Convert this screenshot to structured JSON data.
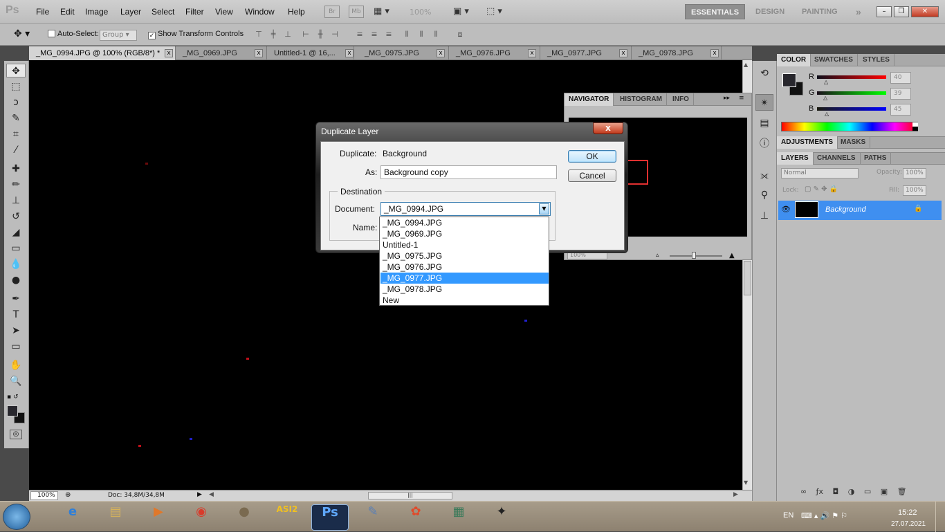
{
  "app": {
    "logo": "Ps"
  },
  "menu": [
    "File",
    "Edit",
    "Image",
    "Layer",
    "Select",
    "Filter",
    "View",
    "Window",
    "Help"
  ],
  "appbar": {
    "br": "Br",
    "mb": "Mb",
    "zoom": "100%"
  },
  "workspaces": {
    "essentials": "ESSENTIALS",
    "design": "DESIGN",
    "painting": "PAINTING",
    "more": "»"
  },
  "window_controls": {
    "minimize": "–",
    "restore": "❐",
    "close": "✕"
  },
  "options": {
    "auto_select_label": "Auto-Select:",
    "auto_select_value": "Group",
    "show_transform_label": "Show Transform Controls"
  },
  "tabs": [
    {
      "label": "_MG_0994.JPG @ 100% (RGB/8*) *"
    },
    {
      "label": "_MG_0969.JPG"
    },
    {
      "label": "Untitled-1 @ 16,..."
    },
    {
      "label": "_MG_0975.JPG"
    },
    {
      "label": "_MG_0976.JPG"
    },
    {
      "label": "_MG_0977.JPG"
    },
    {
      "label": "_MG_0978.JPG"
    }
  ],
  "status": {
    "zoom": "100%",
    "doc": "Doc: 34,8M/34,8M"
  },
  "navigator": {
    "tabs": [
      "NAVIGATOR",
      "HISTOGRAM",
      "INFO"
    ],
    "zoom": "100%"
  },
  "color_panel": {
    "tabs": [
      "COLOR",
      "SWATCHES",
      "STYLES"
    ],
    "channels": [
      {
        "name": "R",
        "value": "40",
        "color": "#e01010"
      },
      {
        "name": "G",
        "value": "39",
        "color": "#10c010"
      },
      {
        "name": "B",
        "value": "45",
        "color": "#1010e0"
      }
    ]
  },
  "adjust_tabs": [
    "ADJUSTMENTS",
    "MASKS"
  ],
  "layers_panel": {
    "tabs": [
      "LAYERS",
      "CHANNELS",
      "PATHS"
    ],
    "blend_mode": "Normal",
    "opacity_label": "Opacity:",
    "opacity": "100%",
    "lock_label": "Lock:",
    "fill_label": "Fill:",
    "fill": "100%",
    "layer_name": "Background"
  },
  "dialog": {
    "title": "Duplicate Layer",
    "duplicate_label": "Duplicate:",
    "duplicate_value": "Background",
    "as_label": "As:",
    "as_value": "Background copy",
    "destination_label": "Destination",
    "document_label": "Document:",
    "document_value": "_MG_0994.JPG",
    "name_label": "Name:",
    "ok": "OK",
    "cancel": "Cancel",
    "close": "x",
    "options": [
      "_MG_0994.JPG",
      "_MG_0969.JPG",
      "Untitled-1",
      "_MG_0975.JPG",
      "_MG_0976.JPG",
      "_MG_0977.JPG",
      "_MG_0978.JPG",
      "New"
    ],
    "highlighted_option": "_MG_0977.JPG"
  },
  "taskbar": {
    "apps": [
      "start",
      "ie",
      "explorer",
      "media",
      "chrome",
      "planet",
      "asi",
      "photoshop",
      "paint",
      "colors",
      "reader",
      "stellarium"
    ],
    "lang": "EN",
    "time": "15:22",
    "date": "27.07.2021"
  }
}
